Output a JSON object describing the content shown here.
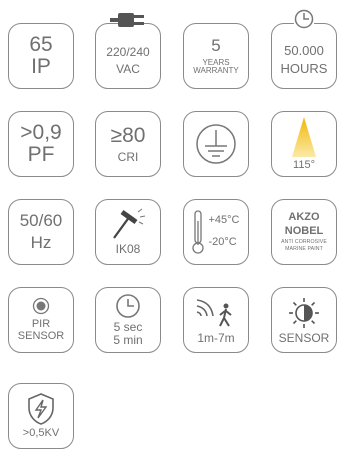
{
  "tiles": {
    "ip": {
      "value": "65",
      "label": "IP"
    },
    "voltage": {
      "value": "220/240",
      "unit": "VAC",
      "icon": "power-plug-icon"
    },
    "warranty": {
      "value": "5",
      "line1": "YEARS",
      "line2": "WARRANTY"
    },
    "hours": {
      "value": "50.000",
      "unit": "HOURS",
      "icon": "clock-icon"
    },
    "pf": {
      "value": ">0,9",
      "label": "PF"
    },
    "cri": {
      "value": "≥80",
      "label": "CRI"
    },
    "ground": {
      "icon": "ground-symbol-icon"
    },
    "beam": {
      "value": "115°",
      "icon": "light-beam-icon"
    },
    "freq": {
      "value": "50/60",
      "unit": "Hz"
    },
    "ik": {
      "value": "IK08",
      "icon": "hammer-impact-icon"
    },
    "temp": {
      "max": "+45°C",
      "min": "-20°C",
      "icon": "thermometer-icon"
    },
    "akzo": {
      "line1": "AKZO",
      "line2": "NOBEL",
      "line3": "ANTI CORROSIVE",
      "line4": "MARINE PAINT"
    },
    "pir": {
      "line1": "PIR",
      "line2": "SENSOR",
      "icon": "pir-sensor-icon"
    },
    "timer": {
      "line1": "5 sec",
      "line2": "5 min",
      "icon": "clock-icon"
    },
    "motion": {
      "value": "1m-7m",
      "icon": "motion-person-icon"
    },
    "sensor": {
      "label": "SENSOR",
      "icon": "light-sensor-icon"
    },
    "surge": {
      "value": ">0,5KV",
      "icon": "surge-shield-icon"
    }
  }
}
